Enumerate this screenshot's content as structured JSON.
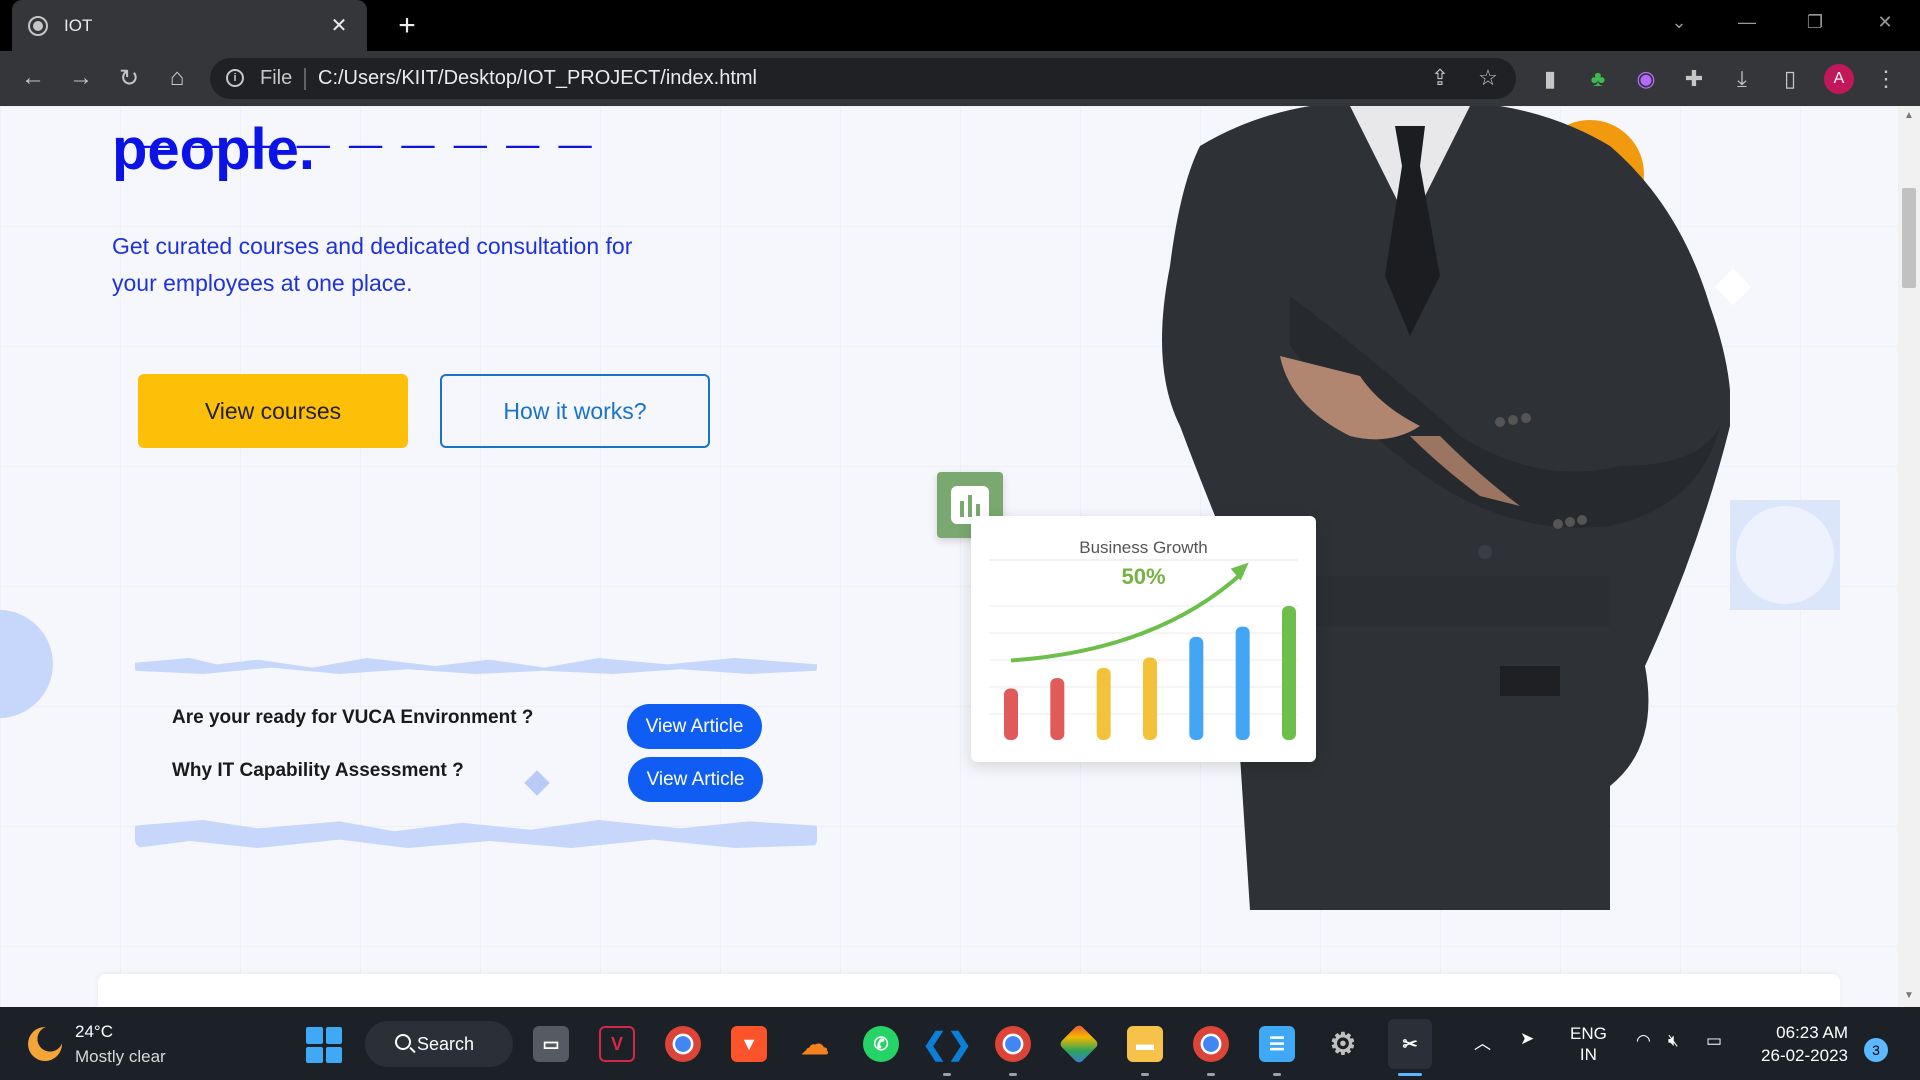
{
  "browser": {
    "tab_title": "IOT",
    "address_scheme": "File",
    "url": "C:/Users/KIIT/Desktop/IOT_PROJECT/index.html",
    "avatar_letter": "A"
  },
  "hero": {
    "title_cut": "_ _ _ _ _ _ _ _ _",
    "title": "people.",
    "subtitle": "Get curated courses and dedicated consultation for your employees at one place.",
    "primary_button": "View courses",
    "secondary_button": "How it works?"
  },
  "articles": [
    {
      "question": "Are your ready for VUCA Environment ?",
      "button": "View Article"
    },
    {
      "question": "Why IT Capability Assessment ?",
      "button": "View Article"
    }
  ],
  "growth_card": {
    "title": "Business Growth",
    "percent": "50%"
  },
  "chart_data": {
    "type": "bar",
    "title": "Business Growth",
    "values": [
      5,
      6,
      7,
      8,
      10,
      11,
      13
    ],
    "colors": [
      "#e05a5a",
      "#e05a5a",
      "#f2c23b",
      "#f2c23b",
      "#42a5f5",
      "#42a5f5",
      "#6cbf4a"
    ],
    "trend_color": "#6cbf4a"
  },
  "taskbar": {
    "temperature": "24°C",
    "condition": "Mostly clear",
    "search_label": "Search",
    "lang_line1": "ENG",
    "lang_line2": "IN",
    "time": "06:23 AM",
    "date": "26-02-2023",
    "notification_count": "3"
  }
}
